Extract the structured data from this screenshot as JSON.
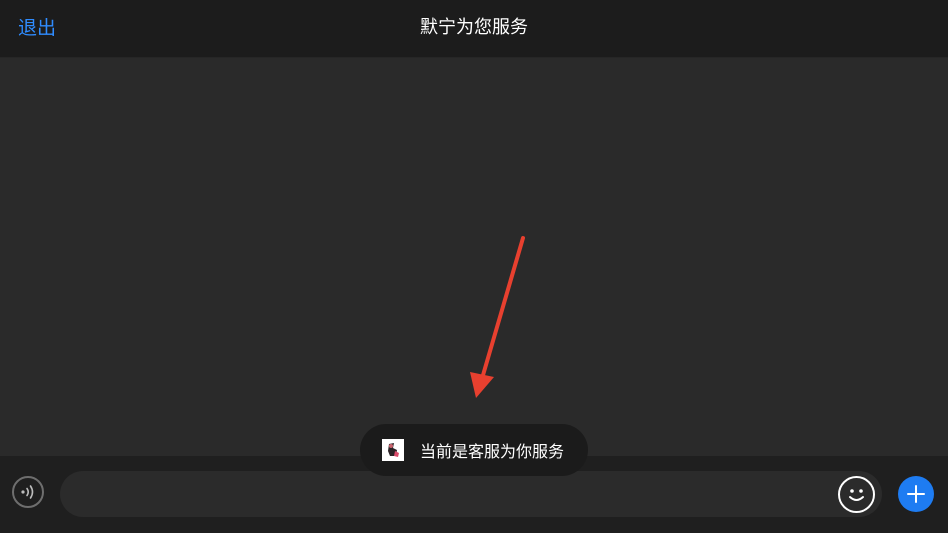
{
  "nav": {
    "exit_label": "退出",
    "title": "默宁为您服务"
  },
  "toast": {
    "text": "当前是客服为你服务",
    "avatar_icon": "service-agent-avatar"
  },
  "input": {
    "value": "",
    "placeholder": ""
  },
  "icons": {
    "voice": "voice-wave-icon",
    "emoji": "smiley-icon",
    "plus": "plus-icon",
    "annotation": "red-arrow"
  },
  "colors": {
    "accent": "#2f8cff",
    "plus_button": "#1e7cf2",
    "arrow": "#e8402f",
    "nav_bg": "#1c1c1c",
    "chat_bg": "#2a2a2a"
  }
}
